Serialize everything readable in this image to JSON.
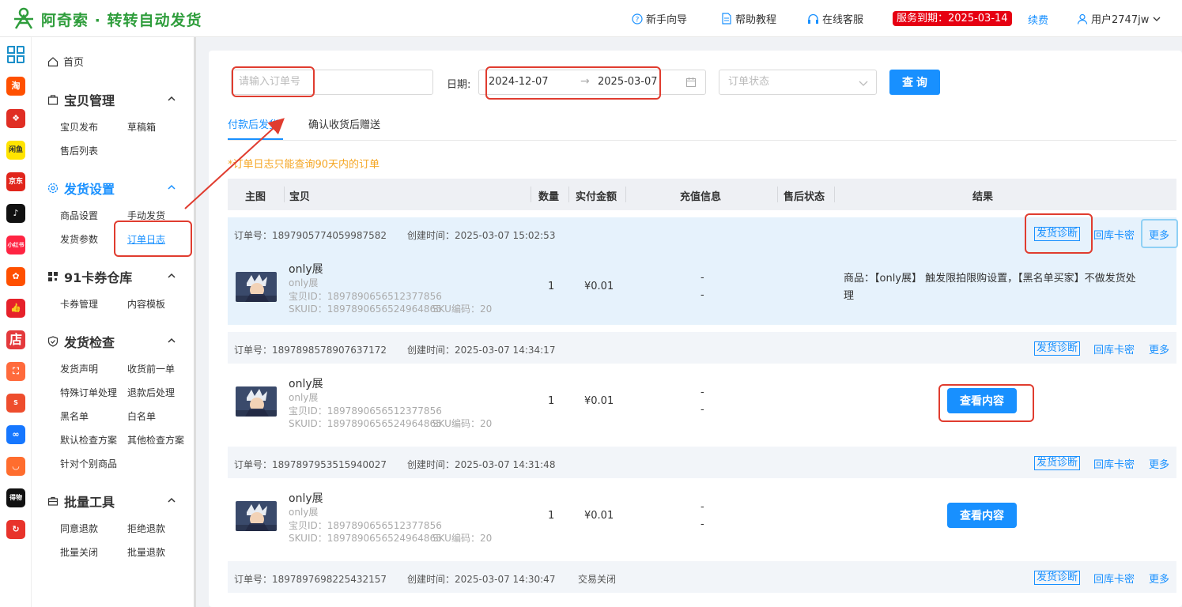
{
  "header": {
    "brand": "阿奇索 · 转转自动发货",
    "guide": "新手向导",
    "tutorial": "帮助教程",
    "support": "在线客服",
    "expiry": "服务到期：2025-03-14",
    "renew": "续费",
    "user": "用户2747jw"
  },
  "iconbar": {
    "items": [
      "grid",
      "淘",
      "拼",
      "闲鱼",
      "京东",
      "抖音",
      "小红书",
      "快",
      "赞",
      "店",
      "购",
      "Shopee",
      "链",
      "鱼",
      "得物",
      "转"
    ]
  },
  "sidebar": {
    "home": "首页",
    "groups": [
      {
        "title": "宝贝管理",
        "items": [
          "宝贝发布",
          "草稿箱",
          "售后列表"
        ]
      },
      {
        "title": "发货设置",
        "items": [
          "商品设置",
          "手动发货",
          "发货参数",
          "订单日志"
        ]
      },
      {
        "title": "91卡券仓库",
        "items": [
          "卡券管理",
          "内容模板"
        ]
      },
      {
        "title": "发货检查",
        "items": [
          "发货声明",
          "收货前一单",
          "特殊订单处理",
          "退款后处理",
          "黑名单",
          "白名单",
          "默认检查方案",
          "其他检查方案",
          "针对个别商品"
        ]
      },
      {
        "title": "批量工具",
        "items": [
          "同意退款",
          "拒绝退款",
          "批量关闭",
          "批量退款"
        ]
      }
    ]
  },
  "filters": {
    "order_placeholder": "请输入订单号",
    "date_label": "日期:",
    "date_start": "2024-12-07",
    "date_arrow": "→",
    "date_end": "2025-03-07",
    "status_placeholder": "订单状态",
    "query": "查 询"
  },
  "tabs": [
    "付款后发货",
    "确认收货后赠送"
  ],
  "notice": "*订单日志只能查询90天内的订单",
  "columns": [
    "主图",
    "宝贝",
    "数量",
    "实付金额",
    "充值信息",
    "售后状态",
    "结果"
  ],
  "actions": {
    "diagnose": "发货诊断",
    "return": "回库卡密",
    "more": "更多"
  },
  "orders": [
    {
      "order_no": "订单号：1897905774059987582",
      "created": "创建时间：2025-03-07 15:02:53",
      "status": "",
      "name": "only展",
      "sub": "only展",
      "item_id": "宝贝ID：1897890656512377856",
      "skuid": "SKUID：1897890656524964865",
      "sku_code": "SKU编码：20",
      "qty": "1",
      "amount": "¥0.01",
      "recharge1": "-",
      "recharge2": "-",
      "result": "商品：【only展】 触发限拍限购设置，【黑名单买家】不做发货处理",
      "button": ""
    },
    {
      "order_no": "订单号：1897898578907637172",
      "created": "创建时间：2025-03-07 14:34:17",
      "status": "",
      "name": "only展",
      "sub": "only展",
      "item_id": "宝贝ID：1897890656512377856",
      "skuid": "SKUID：1897890656524964865",
      "sku_code": "SKU编码：20",
      "qty": "1",
      "amount": "¥0.01",
      "recharge1": "-",
      "recharge2": "-",
      "result": "",
      "button": "查看内容"
    },
    {
      "order_no": "订单号：1897897953515940027",
      "created": "创建时间：2025-03-07 14:31:48",
      "status": "",
      "name": "only展",
      "sub": "only展",
      "item_id": "宝贝ID：1897890656512377856",
      "skuid": "SKUID：1897890656524964865",
      "sku_code": "SKU编码：20",
      "qty": "1",
      "amount": "¥0.01",
      "recharge1": "-",
      "recharge2": "-",
      "result": "",
      "button": "查看内容"
    },
    {
      "order_no": "订单号：1897897698225432157",
      "created": "创建时间：2025-03-07 14:30:47",
      "status": "交易关闭"
    }
  ],
  "colors": {
    "primary": "#1890ff",
    "brand": "#2e9d3b",
    "expiry": "#e60012",
    "notice": "#f5a623",
    "annotation": "#e03c2f"
  }
}
